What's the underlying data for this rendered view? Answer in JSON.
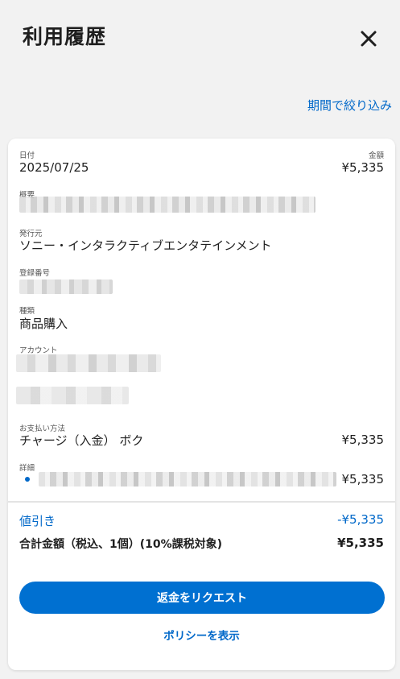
{
  "header": {
    "title": "利用履歴",
    "close_icon": "close-icon"
  },
  "filter": {
    "label": "期間で絞り込み"
  },
  "transaction": {
    "date_label": "日付",
    "date_value": "2025/07/25",
    "amount_label": "金額",
    "amount_value": "¥5,335",
    "summary_label": "概要",
    "publisher_label": "発行元",
    "publisher_value": "ソニー・インタラクティブエンタテインメント",
    "registration_label": "登録番号",
    "type_label": "種類",
    "type_value": "商品購入",
    "account_label": "アカウント",
    "payment_label": "お支払い方法",
    "payment_value": "チャージ（入金） ボク",
    "payment_amount": "¥5,335",
    "detail_label": "詳細",
    "detail_amount": "¥5,335"
  },
  "totals": {
    "discount_label": "値引き",
    "discount_value": "-¥5,335",
    "total_label": "合計金額（税込、1個）(10%課税対象)",
    "total_value": "¥5,335"
  },
  "actions": {
    "refund_label": "返金をリクエスト",
    "policy_label": "ポリシーを表示"
  },
  "colors": {
    "accent": "#0068c9",
    "button": "#0070d1",
    "background": "#f2f2f2",
    "card": "#ffffff"
  }
}
